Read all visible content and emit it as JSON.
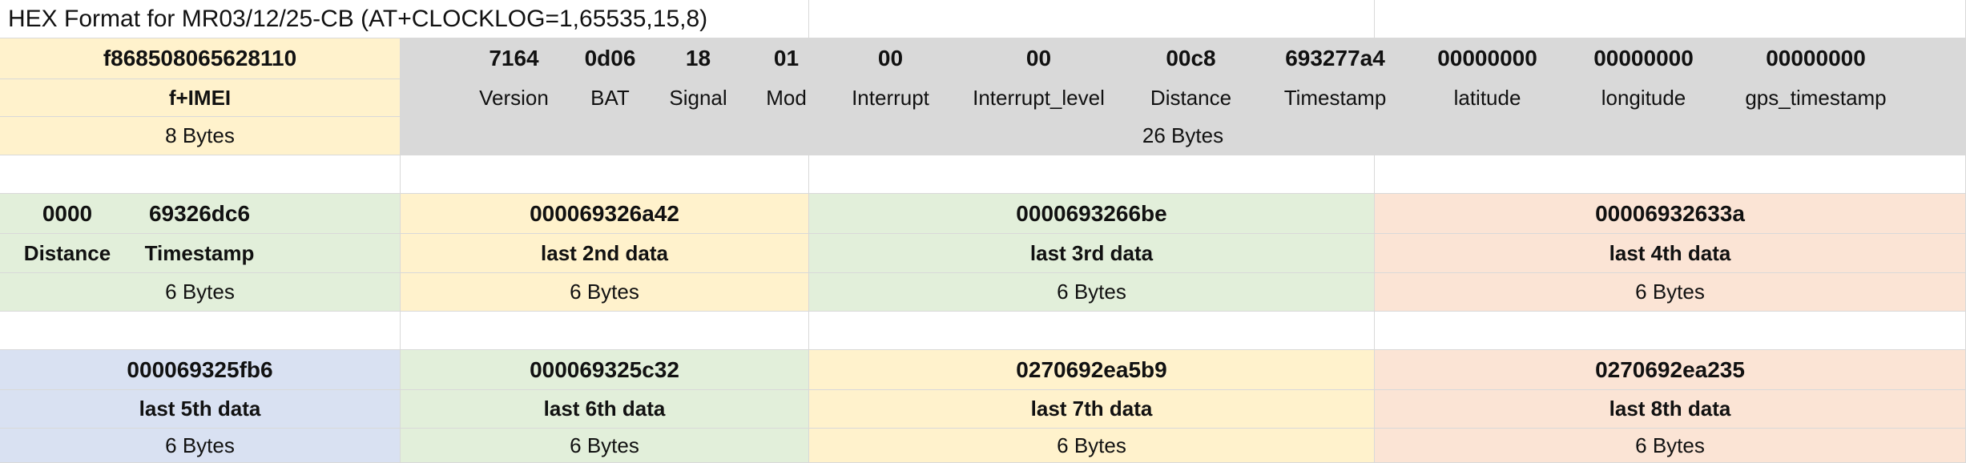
{
  "title": "HEX Format for MR03/12/25-CB (AT+CLOCKLOG=1,65535,15,8)",
  "imei_value": "f868508065628110",
  "imei_label": "f+IMEI",
  "imei_bytes": "8 Bytes",
  "payload_fields": [
    {
      "value": "7164",
      "label": "Version"
    },
    {
      "value": "0d06",
      "label": "BAT"
    },
    {
      "value": "18",
      "label": "Signal"
    },
    {
      "value": "01",
      "label": "Mod"
    },
    {
      "value": "00",
      "label": "Interrupt"
    },
    {
      "value": "00",
      "label": "Interrupt_level"
    },
    {
      "value": "00c8",
      "label": "Distance"
    },
    {
      "value": "693277a4",
      "label": "Timestamp"
    },
    {
      "value": "00000000",
      "label": "latitude"
    },
    {
      "value": "00000000",
      "label": "longitude"
    },
    {
      "value": "00000000",
      "label": "gps_timestamp"
    }
  ],
  "payload_bytes": "26 Bytes",
  "first_log": {
    "distance_value": "0000",
    "timestamp_value": "69326dc6",
    "distance_label": "Distance",
    "timestamp_label": "Timestamp",
    "bytes": "6 Bytes"
  },
  "logs_row1": [
    {
      "value": "000069326a42",
      "label": "last 2nd data",
      "bytes": "6 Bytes"
    },
    {
      "value": "0000693266be",
      "label": "last 3rd data",
      "bytes": "6 Bytes"
    },
    {
      "value": "00006932633a",
      "label": "last 4th data",
      "bytes": "6 Bytes"
    }
  ],
  "logs_row2": [
    {
      "value": "000069325fb6",
      "label": "last 5th data",
      "bytes": "6 Bytes"
    },
    {
      "value": "000069325c32",
      "label": "last 6th data",
      "bytes": "6 Bytes"
    },
    {
      "value": "0270692ea5b9",
      "label": "last 7th data",
      "bytes": "6 Bytes"
    },
    {
      "value": "0270692ea235",
      "label": "last 8th data",
      "bytes": "6 Bytes"
    }
  ],
  "colors": {
    "yellow": "#fff2cc",
    "gray": "#d9d9d9",
    "green": "#e2efda",
    "orange": "#fbe4d5",
    "blue": "#d9e1f2"
  }
}
